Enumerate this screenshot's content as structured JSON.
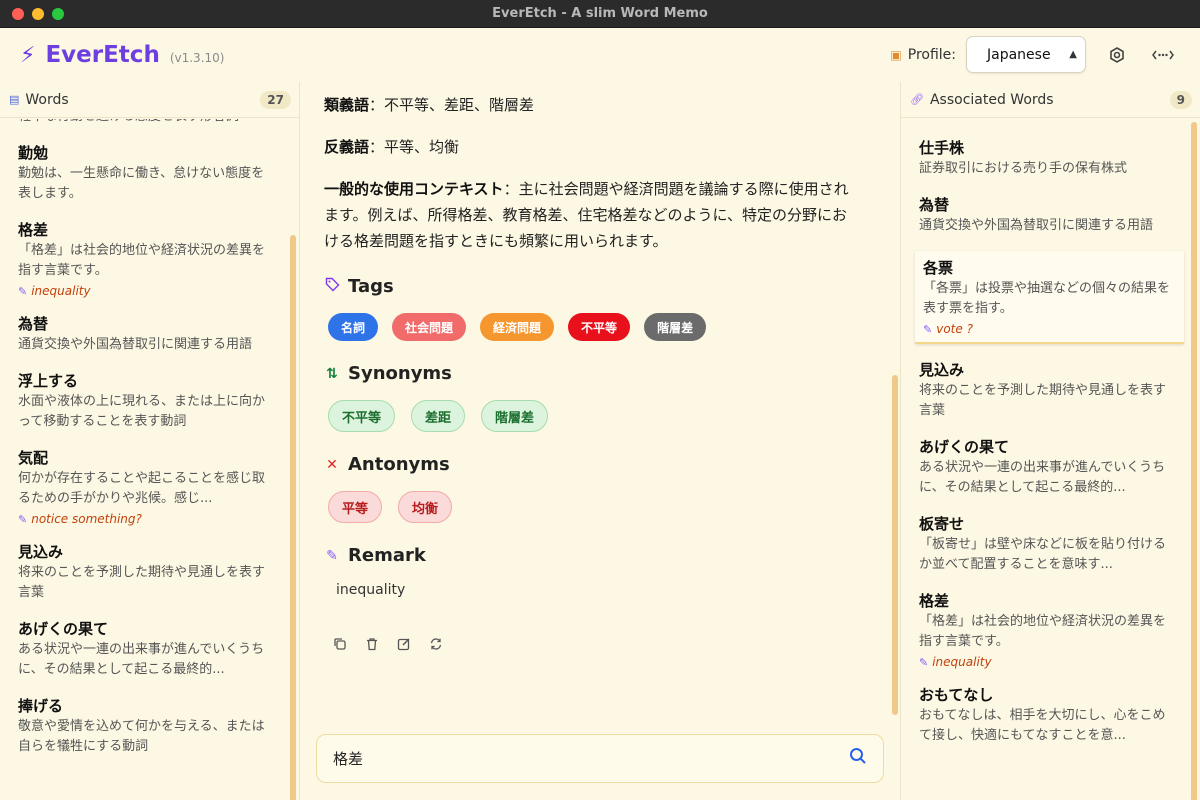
{
  "window": {
    "title": "EverEtch - A slim Word Memo"
  },
  "header": {
    "app_name": "EverEtch",
    "version": "(v1.3.10)",
    "profile_label": "Profile:",
    "profile_value": "Japanese"
  },
  "words_panel": {
    "title": "Words",
    "count": "27",
    "items": [
      {
        "word": "",
        "desc": "軽率な行動を避ける態度を表す形容詞",
        "remark": ""
      },
      {
        "word": "勤勉",
        "desc": "勤勉は、一生懸命に働き、怠けない態度を表します。",
        "remark": ""
      },
      {
        "word": "格差",
        "desc": "「格差」は社会的地位や経済状況の差異を指す言葉です。",
        "remark": "inequality"
      },
      {
        "word": "為替",
        "desc": "通貨交換や外国為替取引に関連する用語",
        "remark": ""
      },
      {
        "word": "浮上する",
        "desc": "水面や液体の上に現れる、または上に向かって移動することを表す動詞",
        "remark": ""
      },
      {
        "word": "気配",
        "desc": "何かが存在することや起こることを感じ取るための手がかりや兆候。感じ...",
        "remark": "notice something?"
      },
      {
        "word": "見込み",
        "desc": "将来のことを予測した期待や見通しを表す言葉",
        "remark": ""
      },
      {
        "word": "あげくの果て",
        "desc": "ある状況や一連の出来事が進んでいくうちに、その結果として起こる最終的...",
        "remark": ""
      },
      {
        "word": "捧げる",
        "desc": "敬意や愛情を込めて何かを与える、または自らを犠牲にする動詞",
        "remark": ""
      }
    ]
  },
  "detail": {
    "synonyms_line": {
      "label": "類義語",
      "sep": "：",
      "text": "不平等、差距、階層差"
    },
    "antonyms_line": {
      "label": "反義語",
      "sep": "：",
      "text": "平等、均衡"
    },
    "context_line": {
      "label": "一般的な使用コンテキスト",
      "sep": "：",
      "text": "主に社会問題や経済問題を議論する際に使用されます。例えば、所得格差、教育格差、住宅格差などのように、特定の分野における格差問題を指すときにも頻繁に用いられます。"
    },
    "tags_title": "Tags",
    "tags": [
      {
        "label": "名詞",
        "color": "#2f73e8"
      },
      {
        "label": "社会問題",
        "color": "#f26b6b"
      },
      {
        "label": "経済問題",
        "color": "#f5962e"
      },
      {
        "label": "不平等",
        "color": "#e8101a"
      },
      {
        "label": "階層差",
        "color": "#6b6b6b"
      }
    ],
    "synonyms_title": "Synonyms",
    "synonyms": [
      "不平等",
      "差距",
      "階層差"
    ],
    "antonyms_title": "Antonyms",
    "antonyms": [
      "平等",
      "均衡"
    ],
    "remark_title": "Remark",
    "remark": "inequality"
  },
  "search": {
    "value": "格差"
  },
  "associated_panel": {
    "title": "Associated Words",
    "count": "9",
    "items": [
      {
        "word": "仕手株",
        "desc": "証券取引における売り手の保有株式",
        "remark": ""
      },
      {
        "word": "為替",
        "desc": "通貨交換や外国為替取引に関連する用語",
        "remark": ""
      },
      {
        "word": "各票",
        "desc": "「各票」は投票や抽選などの個々の結果を表す票を指す。",
        "remark": "vote ?"
      },
      {
        "word": "見込み",
        "desc": "将来のことを予測した期待や見通しを表す言葉",
        "remark": ""
      },
      {
        "word": "あげくの果て",
        "desc": "ある状況や一連の出来事が進んでいくうちに、その結果として起こる最終的...",
        "remark": ""
      },
      {
        "word": "板寄せ",
        "desc": "「板寄せ」は壁や床などに板を貼り付けるか並べて配置することを意味す...",
        "remark": ""
      },
      {
        "word": "格差",
        "desc": "「格差」は社会的地位や経済状況の差異を指す言葉です。",
        "remark": "inequality"
      },
      {
        "word": "おもてなし",
        "desc": "おもてなしは、相手を大切にし、心をこめて接し、快適にもてなすことを意...",
        "remark": ""
      }
    ]
  },
  "colors": {
    "accent": "#6d3fe0",
    "background": "#fdf8e4",
    "search_icon": "#2563eb"
  }
}
